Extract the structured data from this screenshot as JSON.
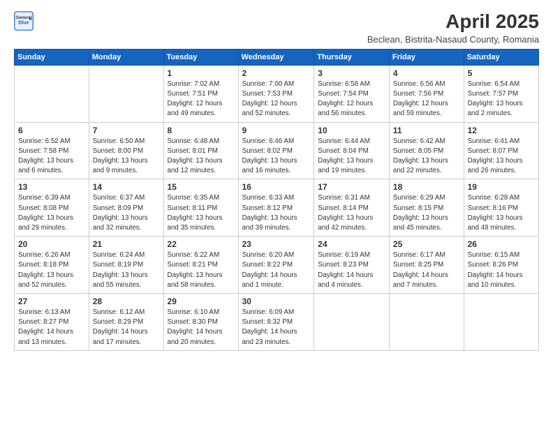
{
  "header": {
    "logo_general": "General",
    "logo_blue": "Blue",
    "main_title": "April 2025",
    "subtitle": "Beclean, Bistrita-Nasaud County, Romania"
  },
  "calendar": {
    "days_of_week": [
      "Sunday",
      "Monday",
      "Tuesday",
      "Wednesday",
      "Thursday",
      "Friday",
      "Saturday"
    ],
    "weeks": [
      [
        {
          "day": "",
          "info": ""
        },
        {
          "day": "",
          "info": ""
        },
        {
          "day": "1",
          "info": "Sunrise: 7:02 AM\nSunset: 7:51 PM\nDaylight: 12 hours and 49 minutes."
        },
        {
          "day": "2",
          "info": "Sunrise: 7:00 AM\nSunset: 7:53 PM\nDaylight: 12 hours and 52 minutes."
        },
        {
          "day": "3",
          "info": "Sunrise: 6:58 AM\nSunset: 7:54 PM\nDaylight: 12 hours and 56 minutes."
        },
        {
          "day": "4",
          "info": "Sunrise: 6:56 AM\nSunset: 7:56 PM\nDaylight: 12 hours and 59 minutes."
        },
        {
          "day": "5",
          "info": "Sunrise: 6:54 AM\nSunset: 7:57 PM\nDaylight: 13 hours and 2 minutes."
        }
      ],
      [
        {
          "day": "6",
          "info": "Sunrise: 6:52 AM\nSunset: 7:58 PM\nDaylight: 13 hours and 6 minutes."
        },
        {
          "day": "7",
          "info": "Sunrise: 6:50 AM\nSunset: 8:00 PM\nDaylight: 13 hours and 9 minutes."
        },
        {
          "day": "8",
          "info": "Sunrise: 6:48 AM\nSunset: 8:01 PM\nDaylight: 13 hours and 12 minutes."
        },
        {
          "day": "9",
          "info": "Sunrise: 6:46 AM\nSunset: 8:02 PM\nDaylight: 13 hours and 16 minutes."
        },
        {
          "day": "10",
          "info": "Sunrise: 6:44 AM\nSunset: 8:04 PM\nDaylight: 13 hours and 19 minutes."
        },
        {
          "day": "11",
          "info": "Sunrise: 6:42 AM\nSunset: 8:05 PM\nDaylight: 13 hours and 22 minutes."
        },
        {
          "day": "12",
          "info": "Sunrise: 6:41 AM\nSunset: 8:07 PM\nDaylight: 13 hours and 26 minutes."
        }
      ],
      [
        {
          "day": "13",
          "info": "Sunrise: 6:39 AM\nSunset: 8:08 PM\nDaylight: 13 hours and 29 minutes."
        },
        {
          "day": "14",
          "info": "Sunrise: 6:37 AM\nSunset: 8:09 PM\nDaylight: 13 hours and 32 minutes."
        },
        {
          "day": "15",
          "info": "Sunrise: 6:35 AM\nSunset: 8:11 PM\nDaylight: 13 hours and 35 minutes."
        },
        {
          "day": "16",
          "info": "Sunrise: 6:33 AM\nSunset: 8:12 PM\nDaylight: 13 hours and 39 minutes."
        },
        {
          "day": "17",
          "info": "Sunrise: 6:31 AM\nSunset: 8:14 PM\nDaylight: 13 hours and 42 minutes."
        },
        {
          "day": "18",
          "info": "Sunrise: 6:29 AM\nSunset: 8:15 PM\nDaylight: 13 hours and 45 minutes."
        },
        {
          "day": "19",
          "info": "Sunrise: 6:28 AM\nSunset: 8:16 PM\nDaylight: 13 hours and 48 minutes."
        }
      ],
      [
        {
          "day": "20",
          "info": "Sunrise: 6:26 AM\nSunset: 8:18 PM\nDaylight: 13 hours and 52 minutes."
        },
        {
          "day": "21",
          "info": "Sunrise: 6:24 AM\nSunset: 8:19 PM\nDaylight: 13 hours and 55 minutes."
        },
        {
          "day": "22",
          "info": "Sunrise: 6:22 AM\nSunset: 8:21 PM\nDaylight: 13 hours and 58 minutes."
        },
        {
          "day": "23",
          "info": "Sunrise: 6:20 AM\nSunset: 8:22 PM\nDaylight: 14 hours and 1 minute."
        },
        {
          "day": "24",
          "info": "Sunrise: 6:19 AM\nSunset: 8:23 PM\nDaylight: 14 hours and 4 minutes."
        },
        {
          "day": "25",
          "info": "Sunrise: 6:17 AM\nSunset: 8:25 PM\nDaylight: 14 hours and 7 minutes."
        },
        {
          "day": "26",
          "info": "Sunrise: 6:15 AM\nSunset: 8:26 PM\nDaylight: 14 hours and 10 minutes."
        }
      ],
      [
        {
          "day": "27",
          "info": "Sunrise: 6:13 AM\nSunset: 8:27 PM\nDaylight: 14 hours and 13 minutes."
        },
        {
          "day": "28",
          "info": "Sunrise: 6:12 AM\nSunset: 8:29 PM\nDaylight: 14 hours and 17 minutes."
        },
        {
          "day": "29",
          "info": "Sunrise: 6:10 AM\nSunset: 8:30 PM\nDaylight: 14 hours and 20 minutes."
        },
        {
          "day": "30",
          "info": "Sunrise: 6:09 AM\nSunset: 8:32 PM\nDaylight: 14 hours and 23 minutes."
        },
        {
          "day": "",
          "info": ""
        },
        {
          "day": "",
          "info": ""
        },
        {
          "day": "",
          "info": ""
        }
      ]
    ]
  }
}
